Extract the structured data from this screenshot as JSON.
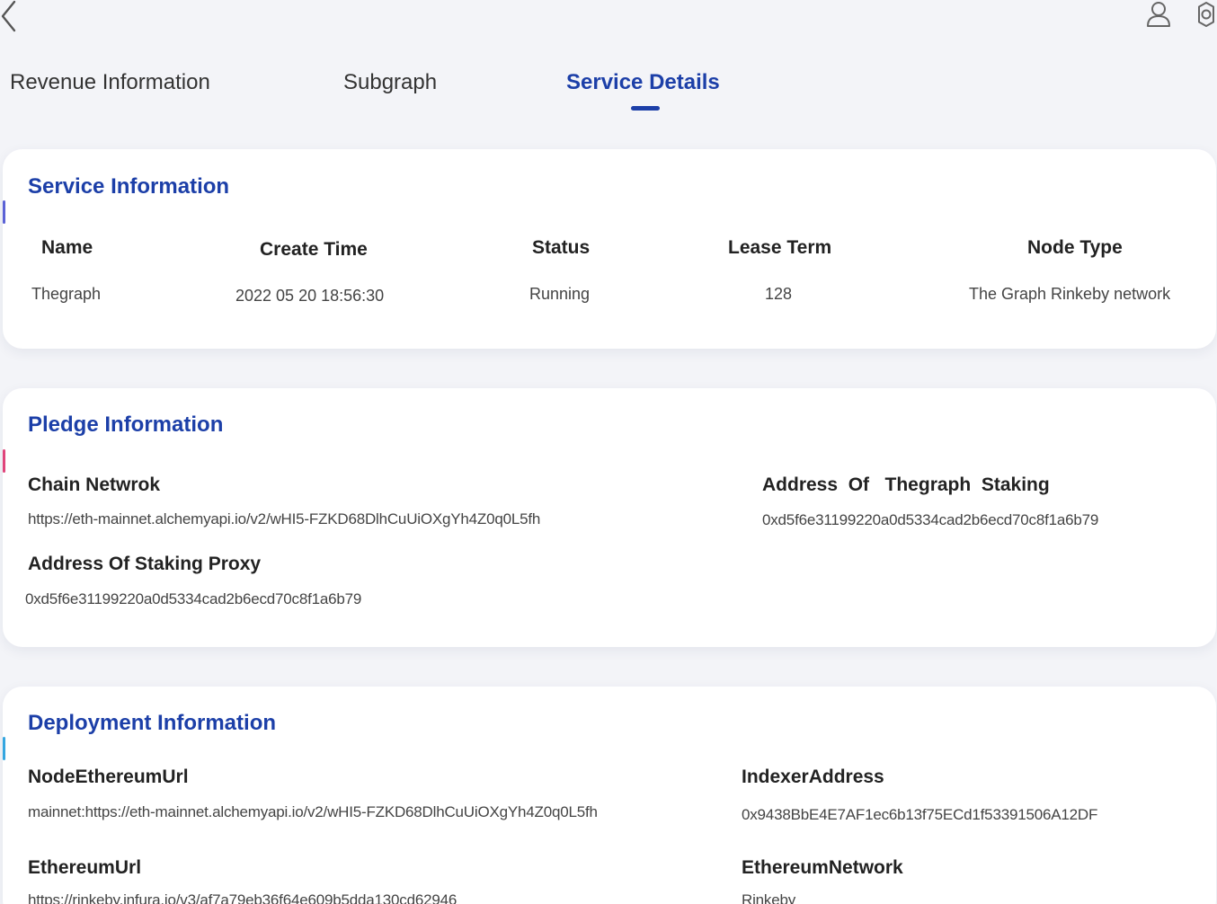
{
  "nav": {
    "back_icon": "chevron-left-icon",
    "user_icon": "user-icon",
    "settings_icon": "gear-icon"
  },
  "tabs": [
    {
      "label": "Revenue Information",
      "active": false
    },
    {
      "label": "Subgraph",
      "active": false
    },
    {
      "label": "Service Details",
      "active": true
    }
  ],
  "colors": {
    "accent": "#1c3fa8",
    "service_bar": "#5b62d6",
    "pledge_bar": "#e0457b",
    "deployment_bar": "#35a6e0"
  },
  "service": {
    "title": "Service Information",
    "headers": [
      "Name",
      "Create Time",
      "Status",
      "Lease Term",
      "Node Type"
    ],
    "row": [
      "Thegraph",
      "2022 05 20 18:56:30",
      "Running",
      "128",
      "The Graph Rinkeby network"
    ]
  },
  "pledge": {
    "title": "Pledge Information",
    "chain_label": "Chain Netwrok",
    "chain_value": "https://eth-mainnet.alchemyapi.io/v2/wHI5-FZKD68DlhCuUiOXgYh4Z0q0L5fh",
    "staking_label": "Address  Of   Thegraph  Staking",
    "staking_value": "0xd5f6e31199220a0d5334cad2b6ecd70c8f1a6b79",
    "proxy_label": "Address Of Staking Proxy",
    "proxy_value": "0xd5f6e31199220a0d5334cad2b6ecd70c8f1a6b79"
  },
  "deployment": {
    "title": "Deployment Information",
    "node_url_label": "NodeEthereumUrl",
    "node_url_value": "mainnet:https://eth-mainnet.alchemyapi.io/v2/wHI5-FZKD68DlhCuUiOXgYh4Z0q0L5fh",
    "indexer_label": "IndexerAddress",
    "indexer_value": "0x9438BbE4E7AF1ec6b13f75ECd1f53391506A12DF",
    "eth_url_label": "EthereumUrl",
    "eth_url_value": "https://rinkeby.infura.io/v3/af7a79eb36f64e609b5dda130cd62946",
    "network_label": "EthereumNetwork",
    "network_value": "Rinkeby"
  }
}
